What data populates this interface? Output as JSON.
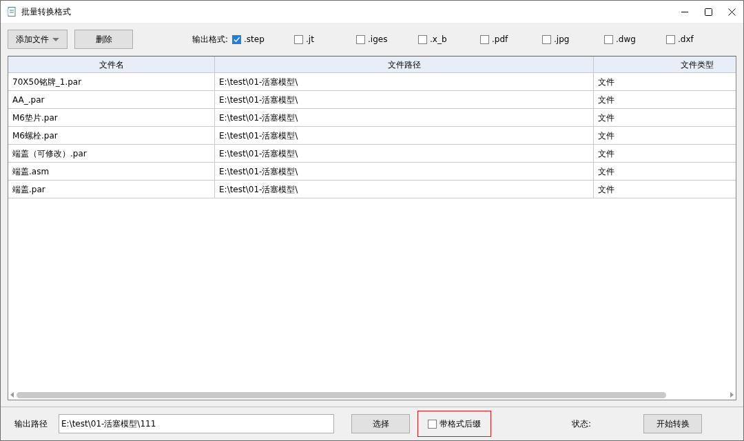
{
  "window": {
    "title": "批量转换格式"
  },
  "toolbar": {
    "add_button": "添加文件",
    "delete_button": "删除",
    "format_label": "输出格式:",
    "formats": [
      {
        "label": ".step",
        "checked": true
      },
      {
        "label": ".jt",
        "checked": false
      },
      {
        "label": ".iges",
        "checked": false
      },
      {
        "label": ".x_b",
        "checked": false
      },
      {
        "label": ".pdf",
        "checked": false
      },
      {
        "label": ".jpg",
        "checked": false
      },
      {
        "label": ".dwg",
        "checked": false
      },
      {
        "label": ".dxf",
        "checked": false
      }
    ]
  },
  "table": {
    "columns": [
      "文件名",
      "文件路径",
      "文件类型"
    ],
    "rows": [
      [
        "70X50铭牌_1.par",
        "E:\\test\\01-活塞模型\\",
        "文件"
      ],
      [
        "AA_.par",
        "E:\\test\\01-活塞模型\\",
        "文件"
      ],
      [
        "M6垫片.par",
        "E:\\test\\01-活塞模型\\",
        "文件"
      ],
      [
        "M6螺栓.par",
        "E:\\test\\01-活塞模型\\",
        "文件"
      ],
      [
        "端盖（可修改）.par",
        "E:\\test\\01-活塞模型\\",
        "文件"
      ],
      [
        "端盖.asm",
        "E:\\test\\01-活塞模型\\",
        "文件"
      ],
      [
        "端盖.par",
        "E:\\test\\01-活塞模型\\",
        "文件"
      ]
    ]
  },
  "footer": {
    "path_label": "输出路径",
    "path_value": "E:\\test\\01-活塞模型\\111",
    "choose_button": "选择",
    "suffix_option": {
      "label": "带格式后缀",
      "checked": false
    },
    "status_label": "状态:",
    "start_button": "开始转换"
  }
}
